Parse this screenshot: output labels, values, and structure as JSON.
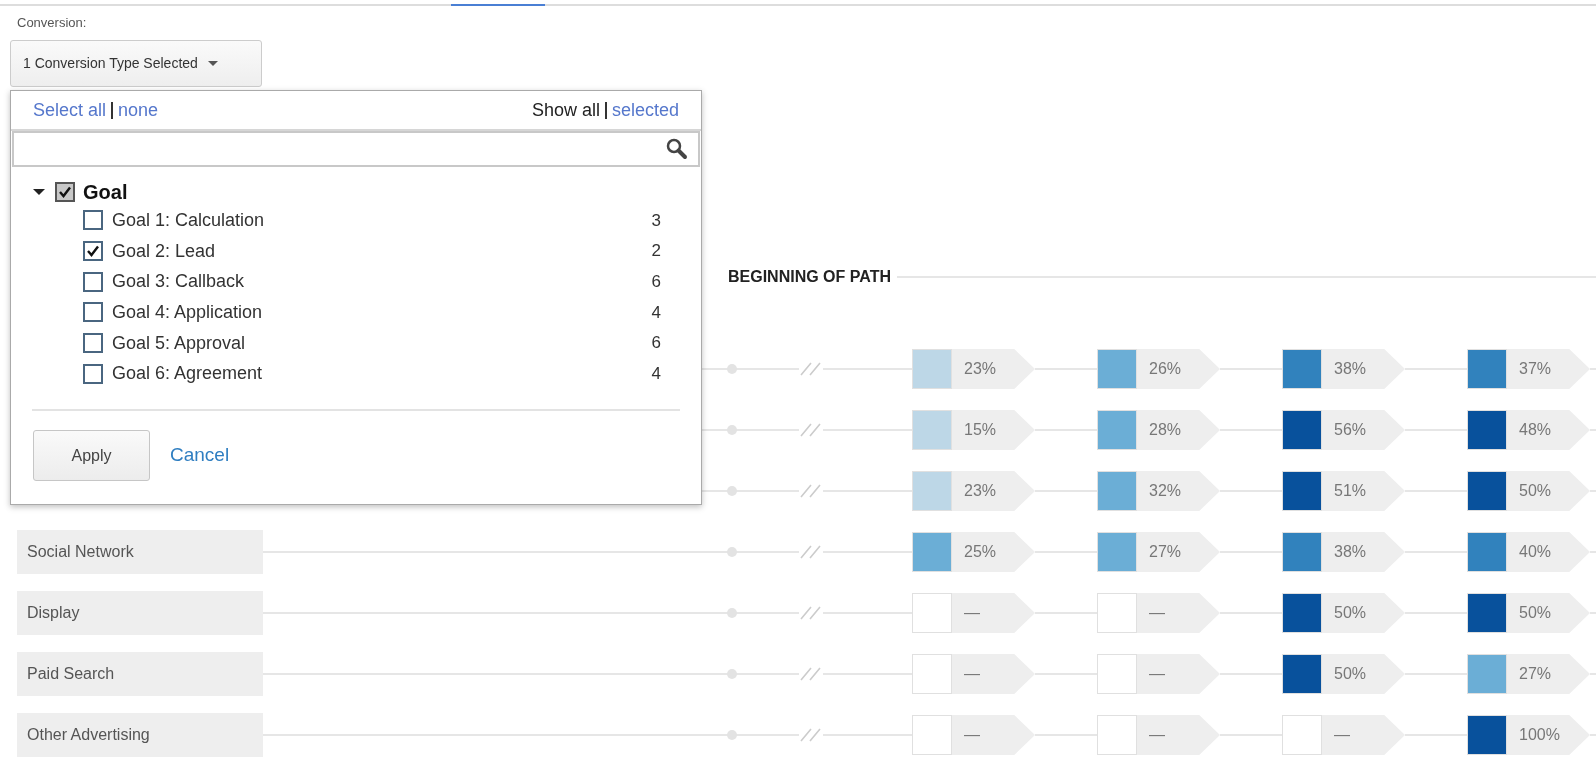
{
  "conversion_label": "Conversion:",
  "conversion_dropdown": {
    "label": "1 Conversion Type Selected",
    "expanded": true
  },
  "popup": {
    "select_links": [
      {
        "label": "Select all"
      },
      {
        "label": "none"
      }
    ],
    "show_options": [
      {
        "label": "Show all",
        "selected": true
      },
      {
        "label": "selected",
        "selected": false
      }
    ],
    "tree": [
      {
        "label": "Goal",
        "checked": true,
        "expanded": true,
        "children": [
          {
            "label": "Goal 1: Calculation",
            "checked": false,
            "count": "3"
          },
          {
            "label": "Goal 2: Lead",
            "checked": true,
            "count": "2"
          },
          {
            "label": "Goal 3: Callback",
            "checked": false,
            "count": "6"
          },
          {
            "label": "Goal 4: Application",
            "checked": false,
            "count": "4"
          },
          {
            "label": "Goal 5: Approval",
            "checked": false,
            "count": "6"
          },
          {
            "label": "Goal 6: Agreement",
            "checked": false,
            "count": "4"
          }
        ]
      }
    ],
    "apply": "Apply",
    "cancel": "Cancel"
  },
  "path_heading": "BEGINNING OF PATH",
  "rows": [
    {
      "cells": [
        {
          "value": "23%",
          "color": "#bdd7e7"
        },
        {
          "value": "26%",
          "color": "#6baed6"
        },
        {
          "value": "38%",
          "color": "#3182bd"
        },
        {
          "value": "37%",
          "color": "#3182bd"
        }
      ]
    },
    {
      "cells": [
        {
          "value": "15%",
          "color": "#bdd7e7"
        },
        {
          "value": "28%",
          "color": "#6baed6"
        },
        {
          "value": "56%",
          "color": "#08519c"
        },
        {
          "value": "48%",
          "color": "#08519c"
        }
      ]
    },
    {
      "cells": [
        {
          "value": "23%",
          "color": "#bdd7e7"
        },
        {
          "value": "32%",
          "color": "#6baed6"
        },
        {
          "value": "51%",
          "color": "#08519c"
        },
        {
          "value": "50%",
          "color": "#08519c"
        }
      ]
    },
    {
      "label": "Social Network",
      "cells": [
        {
          "value": "25%",
          "color": "#6baed6"
        },
        {
          "value": "27%",
          "color": "#6baed6"
        },
        {
          "value": "38%",
          "color": "#3182bd"
        },
        {
          "value": "40%",
          "color": "#3182bd"
        }
      ]
    },
    {
      "label": "Display",
      "cells": [
        {
          "value": "—",
          "color": "#ffffff"
        },
        {
          "value": "—",
          "color": "#ffffff"
        },
        {
          "value": "50%",
          "color": "#08519c"
        },
        {
          "value": "50%",
          "color": "#08519c"
        }
      ]
    },
    {
      "label": "Paid Search",
      "cells": [
        {
          "value": "—",
          "color": "#ffffff"
        },
        {
          "value": "—",
          "color": "#ffffff"
        },
        {
          "value": "50%",
          "color": "#08519c"
        },
        {
          "value": "27%",
          "color": "#6baed6"
        }
      ]
    },
    {
      "label": "Other Advertising",
      "cells": [
        {
          "value": "—",
          "color": "#ffffff"
        },
        {
          "value": "—",
          "color": "#ffffff"
        },
        {
          "value": "—",
          "color": "#ffffff"
        },
        {
          "value": "100%",
          "color": "#08519c"
        }
      ]
    }
  ]
}
